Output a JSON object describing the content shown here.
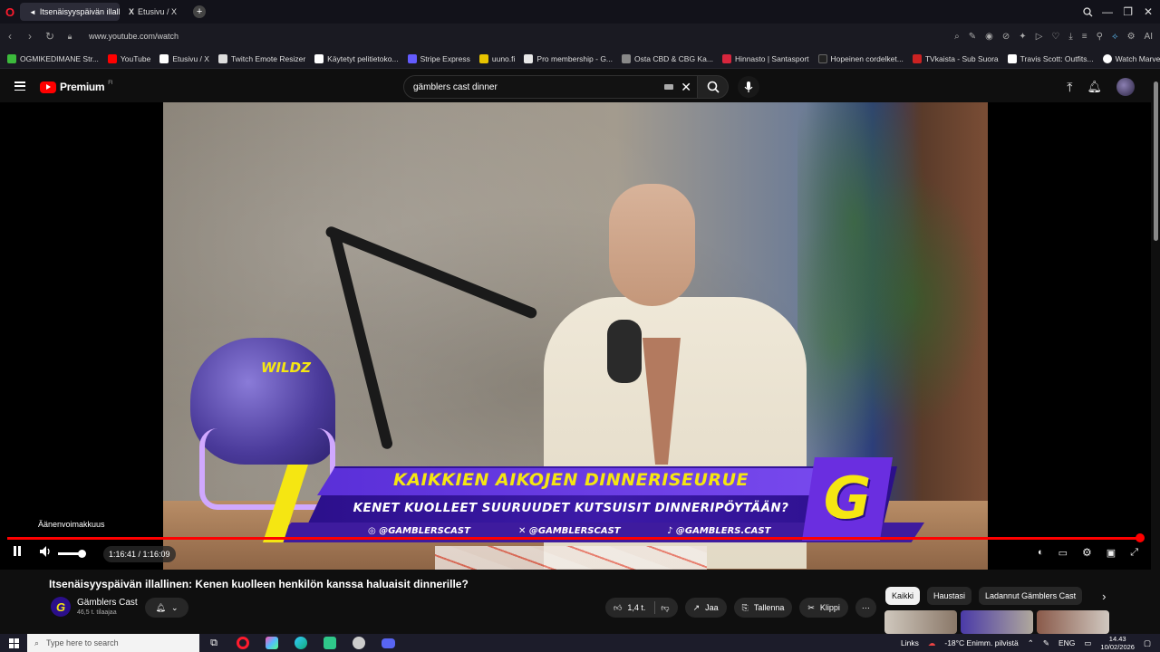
{
  "browser": {
    "tabs": [
      {
        "label": "Itsenäisyyspäivän illallin",
        "active": true
      },
      {
        "label": "Etusivu / X",
        "active": false
      }
    ],
    "url": "www.youtube.com/watch",
    "bookmarks": [
      {
        "label": "OGMIKEDIMANE Str...",
        "color": "#3cba3c"
      },
      {
        "label": "YouTube",
        "color": "#ff0000"
      },
      {
        "label": "Etusivu / X",
        "color": "#ffffff"
      },
      {
        "label": "Twitch Emote Resizer",
        "color": "#dddddd"
      },
      {
        "label": "Käytetyt pelitietoko...",
        "color": "#ffffff"
      },
      {
        "label": "Stripe Express",
        "color": "#635bff"
      },
      {
        "label": "uuno.fi",
        "color": "#e8c400"
      },
      {
        "label": "Pro membership - G...",
        "color": "#e8e8e8"
      },
      {
        "label": "Osta CBD & CBG Ka...",
        "color": "#888888"
      },
      {
        "label": "Hinnasto | Santasport",
        "color": "#d7263d"
      },
      {
        "label": "Hopeinen cordelket...",
        "color": "#222222"
      },
      {
        "label": "TVkaista - Sub Suora",
        "color": "#cc2222"
      },
      {
        "label": "Travis Scott: Outfits...",
        "color": "#ffffff"
      },
      {
        "label": "Watch Marvel's Luk...",
        "color": "#ffffff"
      }
    ]
  },
  "header": {
    "logo_text": "Premium",
    "logo_region": "FI",
    "search_value": "gämblers cast dinner"
  },
  "video": {
    "overlay_title": "KAIKKIEN AIKOJEN DINNERISEURUE",
    "overlay_subtitle": "KENET KUOLLEET SUURUUDET KUTSUISIT DINNERIPÖYTÄÄN?",
    "social_instagram": "@GAMBLERSCAST",
    "social_x": "@GAMBLERSCAST",
    "social_tiktok": "@GAMBLERS.CAST",
    "helmet_text": "WILDZ",
    "badge_letter": "G",
    "tooltip": "Äänenvoimakkuus",
    "time": "1:16:41 / 1:16:09",
    "progress": 1.0
  },
  "info": {
    "title": "Itsenäisyyspäivän illallinen: Kenen kuolleen henkilön kanssa haluaisit dinnerille?",
    "channel": "Gämblers Cast",
    "subscribers": "46,5 t. tilaajaa",
    "like_count": "1,4 t.",
    "share_label": "Jaa",
    "save_label": "Tallenna",
    "clip_label": "Klippi",
    "chips": [
      "Kaikki",
      "Haustasi",
      "Ladannut Gämblers Cast"
    ]
  },
  "taskbar": {
    "search_placeholder": "Type here to search",
    "links_label": "Links",
    "weather": "-18°C  Enimm. pilvistä",
    "language": "ENG",
    "time": "14.43",
    "date": "10/02/2026"
  }
}
